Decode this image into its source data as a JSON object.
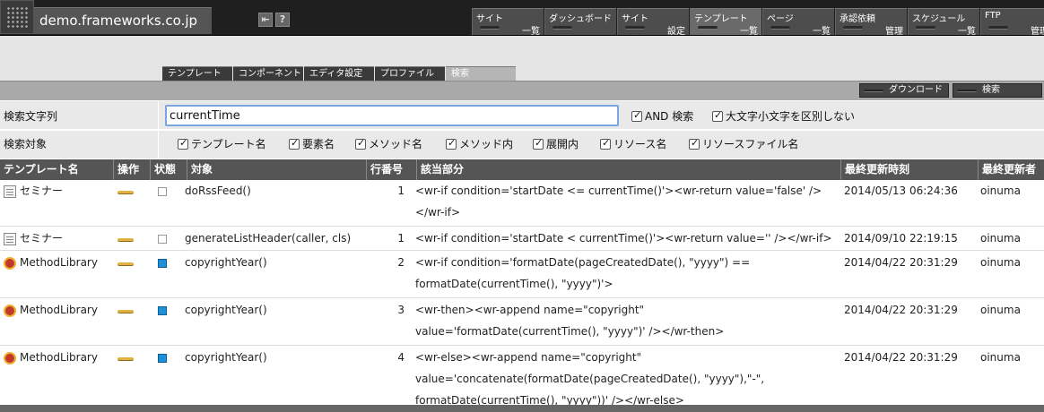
{
  "header": {
    "site_name": "demo.frameworks.co.jp",
    "help_icon_label": "?"
  },
  "nav": [
    {
      "l1": "サイト",
      "l2": "一覧",
      "active": false
    },
    {
      "l1": "ダッシュボード",
      "l2": "",
      "active": false
    },
    {
      "l1": "サイト",
      "l2": "設定",
      "active": false
    },
    {
      "l1": "テンプレート",
      "l2": "一覧",
      "active": true
    },
    {
      "l1": "ページ",
      "l2": "一覧",
      "active": false
    },
    {
      "l1": "承認依頼",
      "l2": "管理",
      "active": false
    },
    {
      "l1": "スケジュール",
      "l2": "一覧",
      "active": false
    },
    {
      "l1": "FTP",
      "l2": "管理",
      "active": false
    }
  ],
  "tabs": [
    "テンプレート",
    "コンポーネント",
    "エディタ設定",
    "プロファイル",
    "検索"
  ],
  "toolbar": {
    "download_label": "ダウンロード",
    "search_label": "検索"
  },
  "search": {
    "query_label": "検索文字列",
    "query_value": "currentTime",
    "and_label": "AND 検索",
    "case_label": "大文字小文字を区別しない",
    "target_label": "検索対象",
    "targets": [
      "テンプレート名",
      "要素名",
      "メソッド名",
      "メソッド内",
      "展開内",
      "リソース名",
      "リソースファイル名"
    ]
  },
  "table": {
    "headers": [
      "テンプレート名",
      "操作",
      "状態",
      "対象",
      "行番号",
      "該当部分",
      "最終更新時刻",
      "最終更新者"
    ],
    "rows": [
      {
        "name": "セミナー",
        "icon": "page-icon",
        "status": "empty",
        "target": "doRssFeed()",
        "line": "1",
        "match": [
          "<wr-if condition='startDate <= currentTime()'><wr-return value='false' />",
          "</wr-if>"
        ],
        "updated": "2014/05/13 06:24:36",
        "user": "oinuma"
      },
      {
        "name": "セミナー",
        "icon": "page-icon",
        "status": "empty",
        "target": "generateListHeader(caller, cls)",
        "line": "1",
        "match": [
          "<wr-if condition='startDate < currentTime()'><wr-return value='' /></wr-if>"
        ],
        "updated": "2014/09/10 22:19:15",
        "user": "oinuma"
      },
      {
        "name": "MethodLibrary",
        "icon": "bug-icon",
        "status": "blue",
        "target": "copyrightYear()",
        "line": "2",
        "match": [
          "<wr-if condition='formatDate(pageCreatedDate(), \"yyyy\") ==",
          "formatDate(currentTime(), \"yyyy\")'>"
        ],
        "updated": "2014/04/22 20:31:29",
        "user": "oinuma"
      },
      {
        "name": "MethodLibrary",
        "icon": "bug-icon",
        "status": "blue",
        "target": "copyrightYear()",
        "line": "3",
        "match": [
          "<wr-then><wr-append name=\"copyright\"",
          "value='formatDate(currentTime(), \"yyyy\")' /></wr-then>"
        ],
        "updated": "2014/04/22 20:31:29",
        "user": "oinuma"
      },
      {
        "name": "MethodLibrary",
        "icon": "bug-icon",
        "status": "blue",
        "target": "copyrightYear()",
        "line": "4",
        "match": [
          "<wr-else><wr-append name=\"copyright\"",
          "value='concatenate(formatDate(pageCreatedDate(), \"yyyy\"),\"-\",",
          "formatDate(currentTime(), \"yyyy\"))' /></wr-else>"
        ],
        "updated": "2014/04/22 20:31:29",
        "user": "oinuma"
      }
    ]
  }
}
